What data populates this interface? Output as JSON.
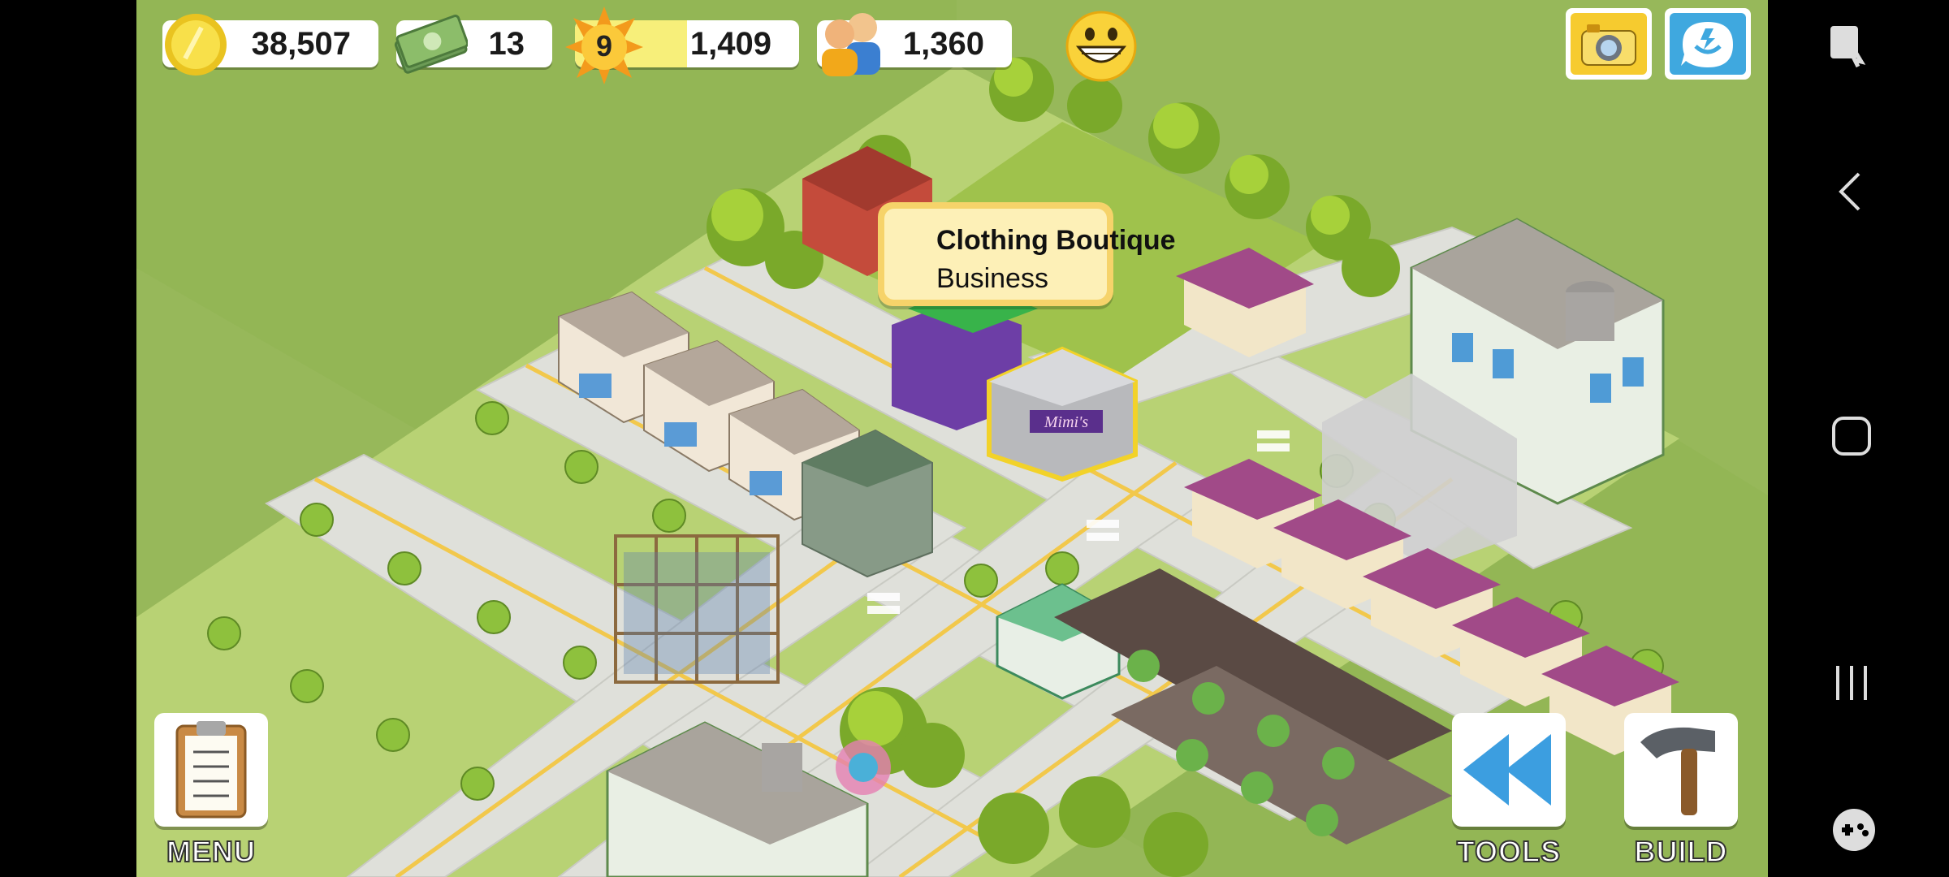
{
  "hud": {
    "coins": "38,507",
    "cash": "13",
    "level": "9",
    "xp": "1,409",
    "xp_fill_fraction": 0.5,
    "population": "1,360"
  },
  "tooltip": {
    "title": "Clothing Boutique",
    "subtitle": "Business"
  },
  "buttons": {
    "menu_label": "MENU",
    "tools_label": "TOOLS",
    "build_label": "BUILD"
  },
  "shop_sign": "Mimi's",
  "icons": {
    "coins": "coin-icon",
    "cash": "cash-icon",
    "level": "sun-star-icon",
    "population": "people-icon",
    "happiness": "smiley-icon",
    "camera": "camera-icon",
    "social": "social-network-icon",
    "menu": "clipboard-icon",
    "tools": "rewind-icon",
    "build": "hammer-icon"
  },
  "colors": {
    "grass": "#97b85a",
    "road": "#dcdcd6",
    "accent_yellow": "#f6d36a"
  }
}
